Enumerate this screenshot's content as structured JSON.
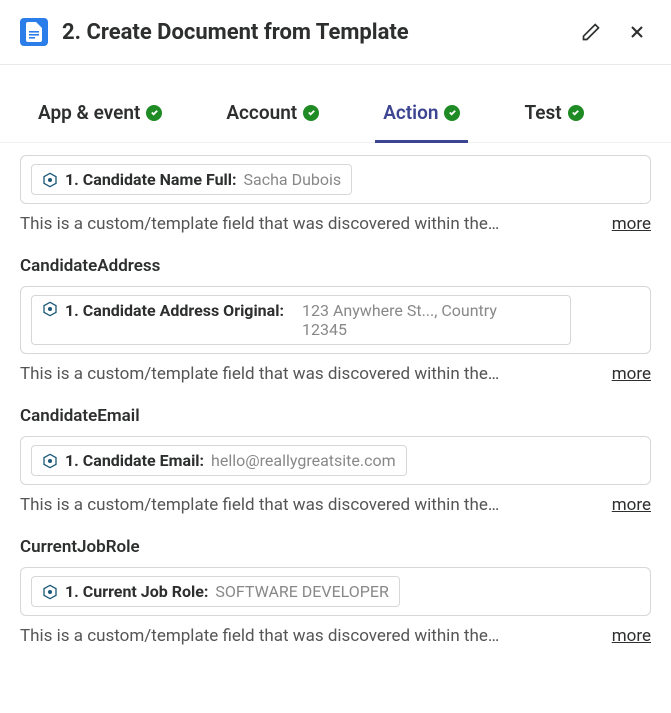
{
  "header": {
    "title": "2. Create Document from Template"
  },
  "tabs": [
    {
      "label": "App & event",
      "active": false
    },
    {
      "label": "Account",
      "active": false
    },
    {
      "label": "Action",
      "active": true
    },
    {
      "label": "Test",
      "active": false
    }
  ],
  "help_text": "This is a custom/template field that was discovered within the…",
  "more_label": "more",
  "fields": [
    {
      "label": "",
      "pill_label": "1. Candidate Name Full:",
      "pill_value": "Sacha Dubois",
      "multiline": false
    },
    {
      "label": "CandidateAddress",
      "pill_label": "1. Candidate Address Original:",
      "pill_value": "123 Anywhere St..., Country 12345",
      "multiline": true
    },
    {
      "label": "CandidateEmail",
      "pill_label": "1. Candidate Email:",
      "pill_value": "hello@reallygreatsite.com",
      "multiline": false
    },
    {
      "label": "CurrentJobRole",
      "pill_label": "1. Current Job Role:",
      "pill_value": "SOFTWARE DEVELOPER",
      "multiline": false
    }
  ]
}
